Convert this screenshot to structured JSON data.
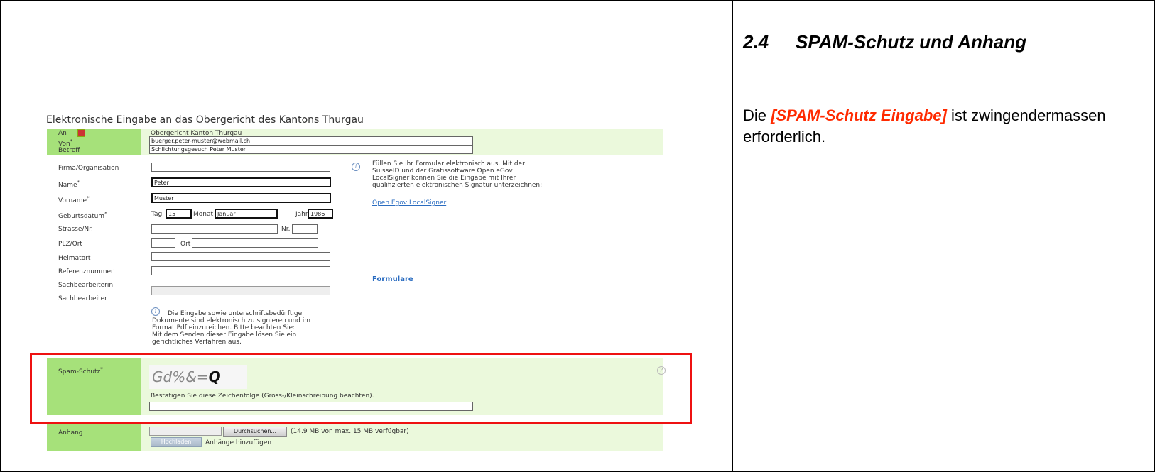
{
  "right_pane": {
    "section_number": "2.4",
    "section_title": "SPAM-Schutz und Anhang",
    "body_prefix": "Die ",
    "body_highlight": "[SPAM-Schutz Eingabe]",
    "body_suffix": " ist zwingendermassen erforderlich."
  },
  "form": {
    "title": "Elektronische Eingabe an das Obergericht des Kantons Thurgau",
    "header": {
      "an_label": "An",
      "an_value": "Obergericht Kanton Thurgau",
      "von_label": "Von",
      "von_value": "buerger.peter-muster@webmail.ch",
      "betreff_label": "Betreff",
      "betreff_value": "Schlichtungsgesuch Peter Muster"
    },
    "fields": {
      "firma_label": "Firma/Organisation",
      "name_label": "Name",
      "name_value": "Peter",
      "vorname_label": "Vorname",
      "vorname_value": "Muster",
      "geburtsdatum_label": "Geburtsdatum",
      "tag_label": "Tag",
      "tag_value": "15",
      "monat_label": "Monat",
      "monat_value": "Januar",
      "jahr_label": "Jahr",
      "jahr_value": "1986",
      "strasse_label": "Strasse/Nr.",
      "nr_label": "Nr.",
      "plz_label": "PLZ/Ort",
      "ort_label": "Ort",
      "heimatort_label": "Heimatort",
      "referenz_label": "Referenznummer",
      "sachbearbeiterin_label": "Sachbearbeiterin",
      "sachbearbeiter_label": "Sachbearbeiter"
    },
    "info_text": "Füllen Sie ihr Formular elektronisch aus. Mit der SuisseID und der Gratissoftware Open eGov LocalSigner können Sie die Eingabe mit Ihrer qualifizierten elektronischen Signatur unterzeichnen:",
    "info_lines": [
      "Füllen Sie ihr Formular elektronisch aus. Mit der",
      "SuisseID und der Gratissoftware Open eGov",
      "LocalSigner können Sie die Eingabe mit Ihrer",
      "qualifizierten elektronischen Signatur unterzeichnen:"
    ],
    "localsigner_link": "Open Egov LocalSigner",
    "formulare_link": "Formulare",
    "notice_lines": [
      "Die Eingabe sowie unterschriftsbedürftige",
      "Dokumente sind elektronisch zu signieren und im",
      "Format Pdf einzureichen. Bitte beachten Sie:",
      "Mit dem Senden dieser Eingabe lösen Sie ein",
      "gerichtliches Verfahren aus."
    ],
    "spam": {
      "label": "Spam-Schutz",
      "captcha_light": "Gd%&=",
      "captcha_dark": "Q",
      "instruction": "Bestätigen Sie diese Zeichenfolge (Gross-/Kleinschreibung beachten).",
      "help_icon": "?"
    },
    "anhang": {
      "label": "Anhang",
      "browse_button": "Durchsuchen...",
      "quota": "(14.9 MB von max. 15 MB verfügbar)",
      "upload_button": "Hochladen",
      "add_label": "Anhänge hinzufügen"
    },
    "required_mark": "*",
    "colors": {
      "label_green": "#a6e17a",
      "panel_green": "#ebf9dc",
      "highlight_red": "#ee1111",
      "link_blue": "#2a6cc0"
    }
  }
}
